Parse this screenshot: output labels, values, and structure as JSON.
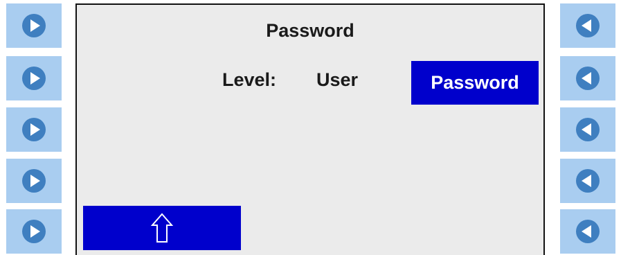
{
  "screen": {
    "title": "Password",
    "level_label": "Level:",
    "level_value": "User",
    "password_button_label": "Password"
  },
  "home_button": {
    "icon": "home-up-arrow-icon"
  },
  "left_softkeys": [
    {
      "icon": "play-right-icon"
    },
    {
      "icon": "play-right-icon"
    },
    {
      "icon": "play-right-icon"
    },
    {
      "icon": "play-right-icon"
    },
    {
      "icon": "play-right-icon"
    }
  ],
  "right_softkeys": [
    {
      "icon": "play-left-icon"
    },
    {
      "icon": "play-left-icon"
    },
    {
      "icon": "play-left-icon"
    },
    {
      "icon": "play-left-icon"
    },
    {
      "icon": "play-left-icon"
    }
  ],
  "colors": {
    "softkey_background": "#a9cdf0",
    "softkey_circle": "#3f7fc0",
    "screen_background": "#ebebeb",
    "accent_blue": "#0000cc",
    "text": "#1a1a1a"
  }
}
